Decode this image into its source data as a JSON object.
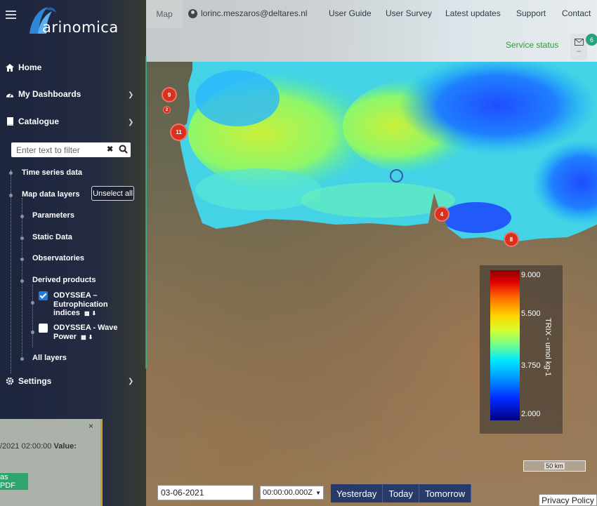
{
  "app": {
    "logo_text": "arinomica",
    "logo_letter": "M"
  },
  "topnav": {
    "map_tab": "Map",
    "user_email": "lorinc.meszaros@deltares.nl",
    "links": [
      "User Guide",
      "User Survey",
      "Latest updates",
      "Support",
      "Contact"
    ],
    "service_status": "Service status",
    "message_count": "6",
    "message_dash": "–"
  },
  "sidebar": {
    "home": "Home",
    "dashboards": "My Dashboards",
    "catalogue": "Catalogue",
    "filter_placeholder": "Enter text to filter",
    "tree": {
      "time_series": "Time series data",
      "map_layers": "Map data layers",
      "unselect_all": "Unselect all",
      "parameters": "Parameters",
      "static_data": "Static Data",
      "observatories": "Observatories",
      "derived_products": "Derived products",
      "layers": [
        {
          "name": "ODYSSEA – Eutrophication indices",
          "checked": true
        },
        {
          "name": "ODYSSEA - Wave Power",
          "checked": false
        }
      ],
      "all_layers": "All layers"
    },
    "settings": "Settings"
  },
  "popup": {
    "text_prefix": "/2021 02:00:00",
    "value_label": "Value:",
    "pdf_button": "as PDF",
    "close": "×"
  },
  "legend": {
    "title": "TRIX - umol kg-1",
    "values": [
      "9.000",
      "5.500",
      "3.750",
      "2.000"
    ]
  },
  "scale_bar": "50 km",
  "map_markers": [
    "9",
    "2",
    "11",
    "4",
    "8"
  ],
  "controls": {
    "date": "03-06-2021",
    "time": "00:00:00.000Z",
    "yesterday": "Yesterday",
    "today": "Today",
    "tomorrow": "Tomorrow",
    "privacy": "Privacy Policy"
  },
  "colors": {
    "accent": "#283a6a",
    "status_green": "#2f9d3a",
    "badge": "#26a37a",
    "marker": "#d8321f",
    "checkbox": "#1f7ae0"
  }
}
